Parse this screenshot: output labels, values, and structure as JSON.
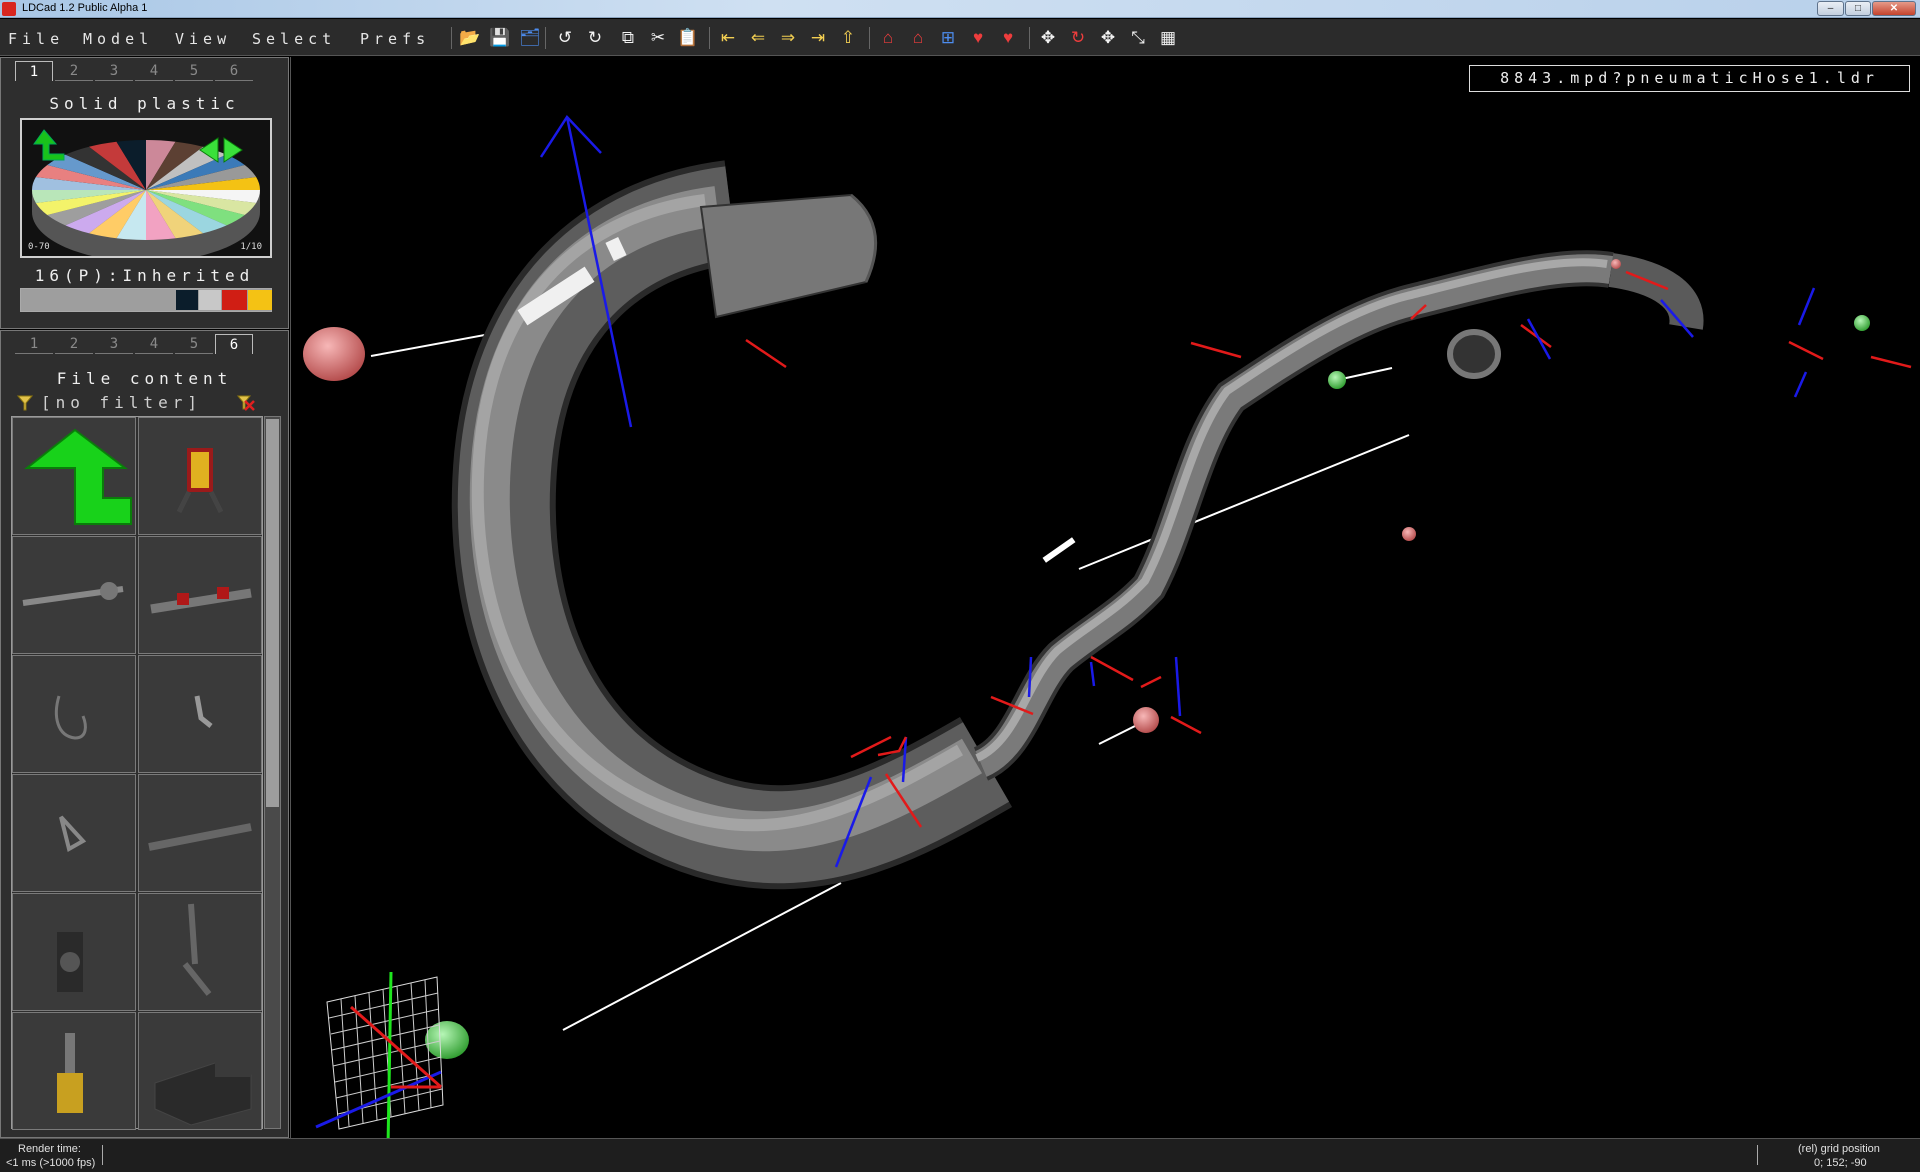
{
  "window": {
    "title": "LDCad 1.2 Public Alpha 1",
    "controls": [
      "–",
      "□",
      "✕"
    ]
  },
  "menu": [
    "File",
    "Model",
    "View",
    "Select",
    "Prefs"
  ],
  "toolbar": {
    "icons": [
      {
        "name": "open-icon",
        "glyph": "📂",
        "color": "y"
      },
      {
        "name": "save-icon",
        "glyph": "💾",
        "color": "b"
      },
      {
        "name": "save-all-icon",
        "glyph": "🗂",
        "color": "b"
      },
      {
        "name": "undo-icon",
        "glyph": "↺",
        "color": "w"
      },
      {
        "name": "redo-icon",
        "glyph": "↻",
        "color": "w"
      },
      {
        "name": "copy-icon",
        "glyph": "⧉",
        "color": "w"
      },
      {
        "name": "cut-icon",
        "glyph": "✂",
        "color": "w"
      },
      {
        "name": "paste-icon",
        "glyph": "📋",
        "color": "w"
      },
      {
        "name": "nav-first-icon",
        "glyph": "⇤",
        "color": "y"
      },
      {
        "name": "nav-prev-icon",
        "glyph": "⇐",
        "color": "y"
      },
      {
        "name": "nav-next-icon",
        "glyph": "⇒",
        "color": "y"
      },
      {
        "name": "nav-last-icon",
        "glyph": "⇥",
        "color": "y"
      },
      {
        "name": "nav-add-icon",
        "glyph": "⇧",
        "color": "y"
      },
      {
        "name": "house-icon",
        "glyph": "⌂",
        "color": "r"
      },
      {
        "name": "house-add-icon",
        "glyph": "⌂",
        "color": "r"
      },
      {
        "name": "grid-r-icon",
        "glyph": "⊞",
        "color": "b"
      },
      {
        "name": "heart-icon",
        "glyph": "♥",
        "color": "r"
      },
      {
        "name": "heart-broken-icon",
        "glyph": "♥",
        "color": "r"
      },
      {
        "name": "move-icon",
        "glyph": "✥",
        "color": "w"
      },
      {
        "name": "rotate-icon",
        "glyph": "↻",
        "color": "r"
      },
      {
        "name": "pan-icon",
        "glyph": "✥",
        "color": "w"
      },
      {
        "name": "resize-icon",
        "glyph": "⤡",
        "color": "w"
      },
      {
        "name": "grid-snap-icon",
        "glyph": "▦",
        "color": "w"
      }
    ]
  },
  "color_panel": {
    "tabs": [
      "1",
      "2",
      "3",
      "4",
      "5",
      "6"
    ],
    "active_tab": "1",
    "title": "Solid plastic",
    "range_label": "0-70",
    "page_label": "1/10",
    "current_color": "16(P):Inherited",
    "swatches": [
      "#9e9e9e",
      "#0b1d2b",
      "#c8c8c8",
      "#d01e14",
      "#f4c214"
    ]
  },
  "parts_panel": {
    "tabs": [
      "1",
      "2",
      "3",
      "4",
      "5",
      "6"
    ],
    "active_tab": "6",
    "title": "File content",
    "filter_text": "[no filter]"
  },
  "viewport": {
    "file_label": "8843.mpd?pneumaticHose1.ldr"
  },
  "status": {
    "render_label": "Render time:",
    "render_value": "<1 ms (>1000 fps)",
    "grid_label": "(rel) grid position",
    "grid_value": "0; 152; -90"
  }
}
